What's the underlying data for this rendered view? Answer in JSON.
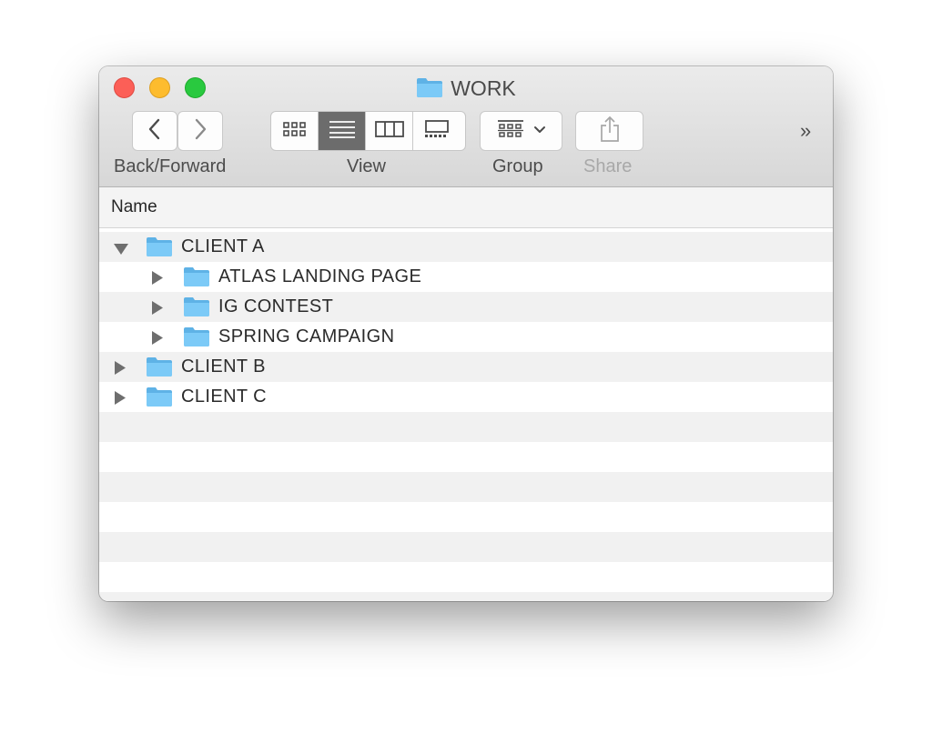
{
  "window": {
    "title": "WORK"
  },
  "toolbar": {
    "back_forward_label": "Back/Forward",
    "view_label": "View",
    "group_label": "Group",
    "share_label": "Share",
    "overflow": "»"
  },
  "header": {
    "name_column": "Name"
  },
  "rows": [
    {
      "label": "CLIENT A",
      "level": 0,
      "expanded": true
    },
    {
      "label": "ATLAS LANDING PAGE",
      "level": 1,
      "expanded": false
    },
    {
      "label": "IG CONTEST",
      "level": 1,
      "expanded": false
    },
    {
      "label": "SPRING CAMPAIGN",
      "level": 1,
      "expanded": false
    },
    {
      "label": "CLIENT B",
      "level": 0,
      "expanded": false
    },
    {
      "label": "CLIENT C",
      "level": 0,
      "expanded": false
    }
  ],
  "colors": {
    "folder": "#6fc3f5",
    "folder_tab": "#5eb2e6",
    "close": "#fc5f57",
    "minimize": "#fdbc2e",
    "maximize": "#29c93f"
  }
}
